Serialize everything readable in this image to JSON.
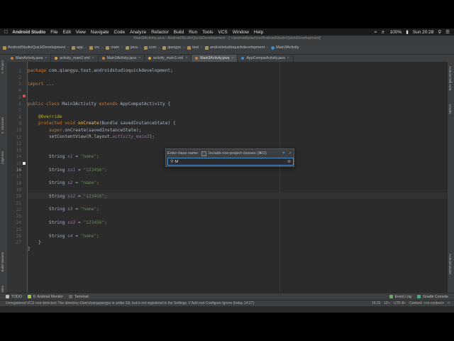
{
  "menubar": {
    "app_name": "Android Studio",
    "items": [
      "File",
      "Edit",
      "View",
      "Navigate",
      "Code",
      "Analyze",
      "Refactor",
      "Build",
      "Run",
      "Tools",
      "VCS",
      "Window",
      "Help"
    ],
    "battery": "100%",
    "clock": "Sun 20:28"
  },
  "window": {
    "title": "Main3Activity.java - AndroidStudioQuickDevelopment - [~/android/practice/AndroidStudioQuickDevelopment]"
  },
  "breadcrumb": [
    "AndroidStudioQuickDevelopment",
    "app",
    "src",
    "main",
    "java",
    "com",
    "qiangyu",
    "test",
    "androidstudioquickdevelopment",
    "Main3Activity"
  ],
  "toolbar": {
    "run_config": "app"
  },
  "tabs": [
    {
      "label": "MainActivity.java",
      "active": false
    },
    {
      "label": "activity_main2.xml",
      "active": false
    },
    {
      "label": "Main2Activity.java",
      "active": false
    },
    {
      "label": "activity_main3.xml",
      "active": false
    },
    {
      "label": "Main3Activity.java",
      "active": true
    },
    {
      "label": "AppCompatActivity.java",
      "active": false
    }
  ],
  "left_panels": [
    "1: Project",
    "2: Structure",
    "Captures",
    "Build Variants",
    "2: Favorites"
  ],
  "right_panels": [
    "Android Wifi ADB",
    "Gradle",
    "Android Model"
  ],
  "line_numbers": [
    "1",
    "2",
    "3",
    "4",
    "5",
    "6",
    "7",
    "8",
    "9",
    "10",
    "11",
    "12",
    "13",
    "14",
    "15",
    "16",
    "17",
    "18",
    "19",
    "20",
    "21",
    "22",
    "23",
    "24",
    "25",
    "26",
    "27"
  ],
  "code": {
    "l1_kw": "package",
    "l1_rest": " com.qiangyu.test.androidstudioquickdevelopment;",
    "l3_kw": "import",
    "l3_rest": " ...",
    "l6_kw": "public class",
    "l6_name": " Main3Activity ",
    "l6_kw2": "extends",
    "l6_rest": " AppCompatActivity {",
    "l8_ann": "@Override",
    "l9_kw": "protected void",
    "l9_fn": " onCreate",
    "l9_rest": "(Bundle savedInstanceState) {",
    "l10_kw": "super",
    "l10_rest": ".onCreate(savedInstanceState);",
    "l11_rest": "setContentView(R.layout.",
    "l11_it": "activity_main3",
    "l11_end": ");",
    "strings": [
      {
        "line": 14,
        "type": "String ",
        "var": "s1",
        "value": "\"name\""
      },
      {
        "line": 16,
        "type": "String ",
        "var": "ss1",
        "value": "\"123456\""
      },
      {
        "line": 18,
        "type": "String ",
        "var": "s2",
        "value": "\"name\""
      },
      {
        "line": 20,
        "type": "String ",
        "var": "ss2",
        "value": "\"123456\""
      },
      {
        "line": 22,
        "type": "String ",
        "var": "s3",
        "value": "\"name\""
      },
      {
        "line": 24,
        "type": "String ",
        "var": "ss3",
        "value": "\"123456\""
      },
      {
        "line": 26,
        "type": "String ",
        "var": "s4",
        "value": "\"name\""
      }
    ],
    "close_inner": "}",
    "close_outer": "}"
  },
  "popup": {
    "label": "Enter class name:",
    "checkbox_label": "Include non-project classes (⌘O)",
    "search_value": "M"
  },
  "bottom_tools": [
    "TODO",
    "6: Android Monitor",
    "Terminal"
  ],
  "bottom_tools_right": [
    "Event Log",
    "Gradle Console"
  ],
  "status": {
    "message": "Unregistered VCS root detected: The directory /Users/yangqiangyu is under Git, but is not registered in the Settings. // Add root  Configure  Ignore (today 14:27)",
    "position": "16:31",
    "line_sep": "LF÷",
    "encoding": "UTF-8÷",
    "context": "Context: <no context>"
  },
  "colors": {
    "editor_bg": "#2b2b2b",
    "keyword": "#cc7832",
    "string": "#6a8759",
    "annotation": "#bbb529",
    "function": "#ffc66d"
  }
}
